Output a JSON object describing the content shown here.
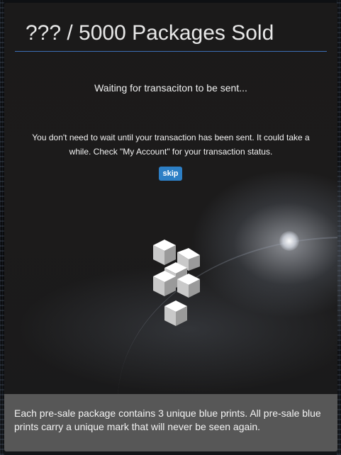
{
  "header": {
    "title": "??? / 5000 Packages Sold"
  },
  "status": {
    "waiting_text": "Waiting for transaciton to be sent..."
  },
  "info": {
    "message": "You don't need to wait until your transaction has been sent. It could take a while. Check \"My Account\" for your transaction status."
  },
  "actions": {
    "skip_label": "skip"
  },
  "loader": {
    "icon": "cube-stack-loading-icon"
  },
  "footer": {
    "text": "Each pre-sale package contains 3 unique blue prints. All pre-sale blue prints carry a unique mark that will never be seen again."
  },
  "colors": {
    "accent_line": "#3d6fb6",
    "button": "#2d7fc5",
    "panel_bg": "#1b1a1a",
    "footer_bg": "#5c5c5c"
  }
}
